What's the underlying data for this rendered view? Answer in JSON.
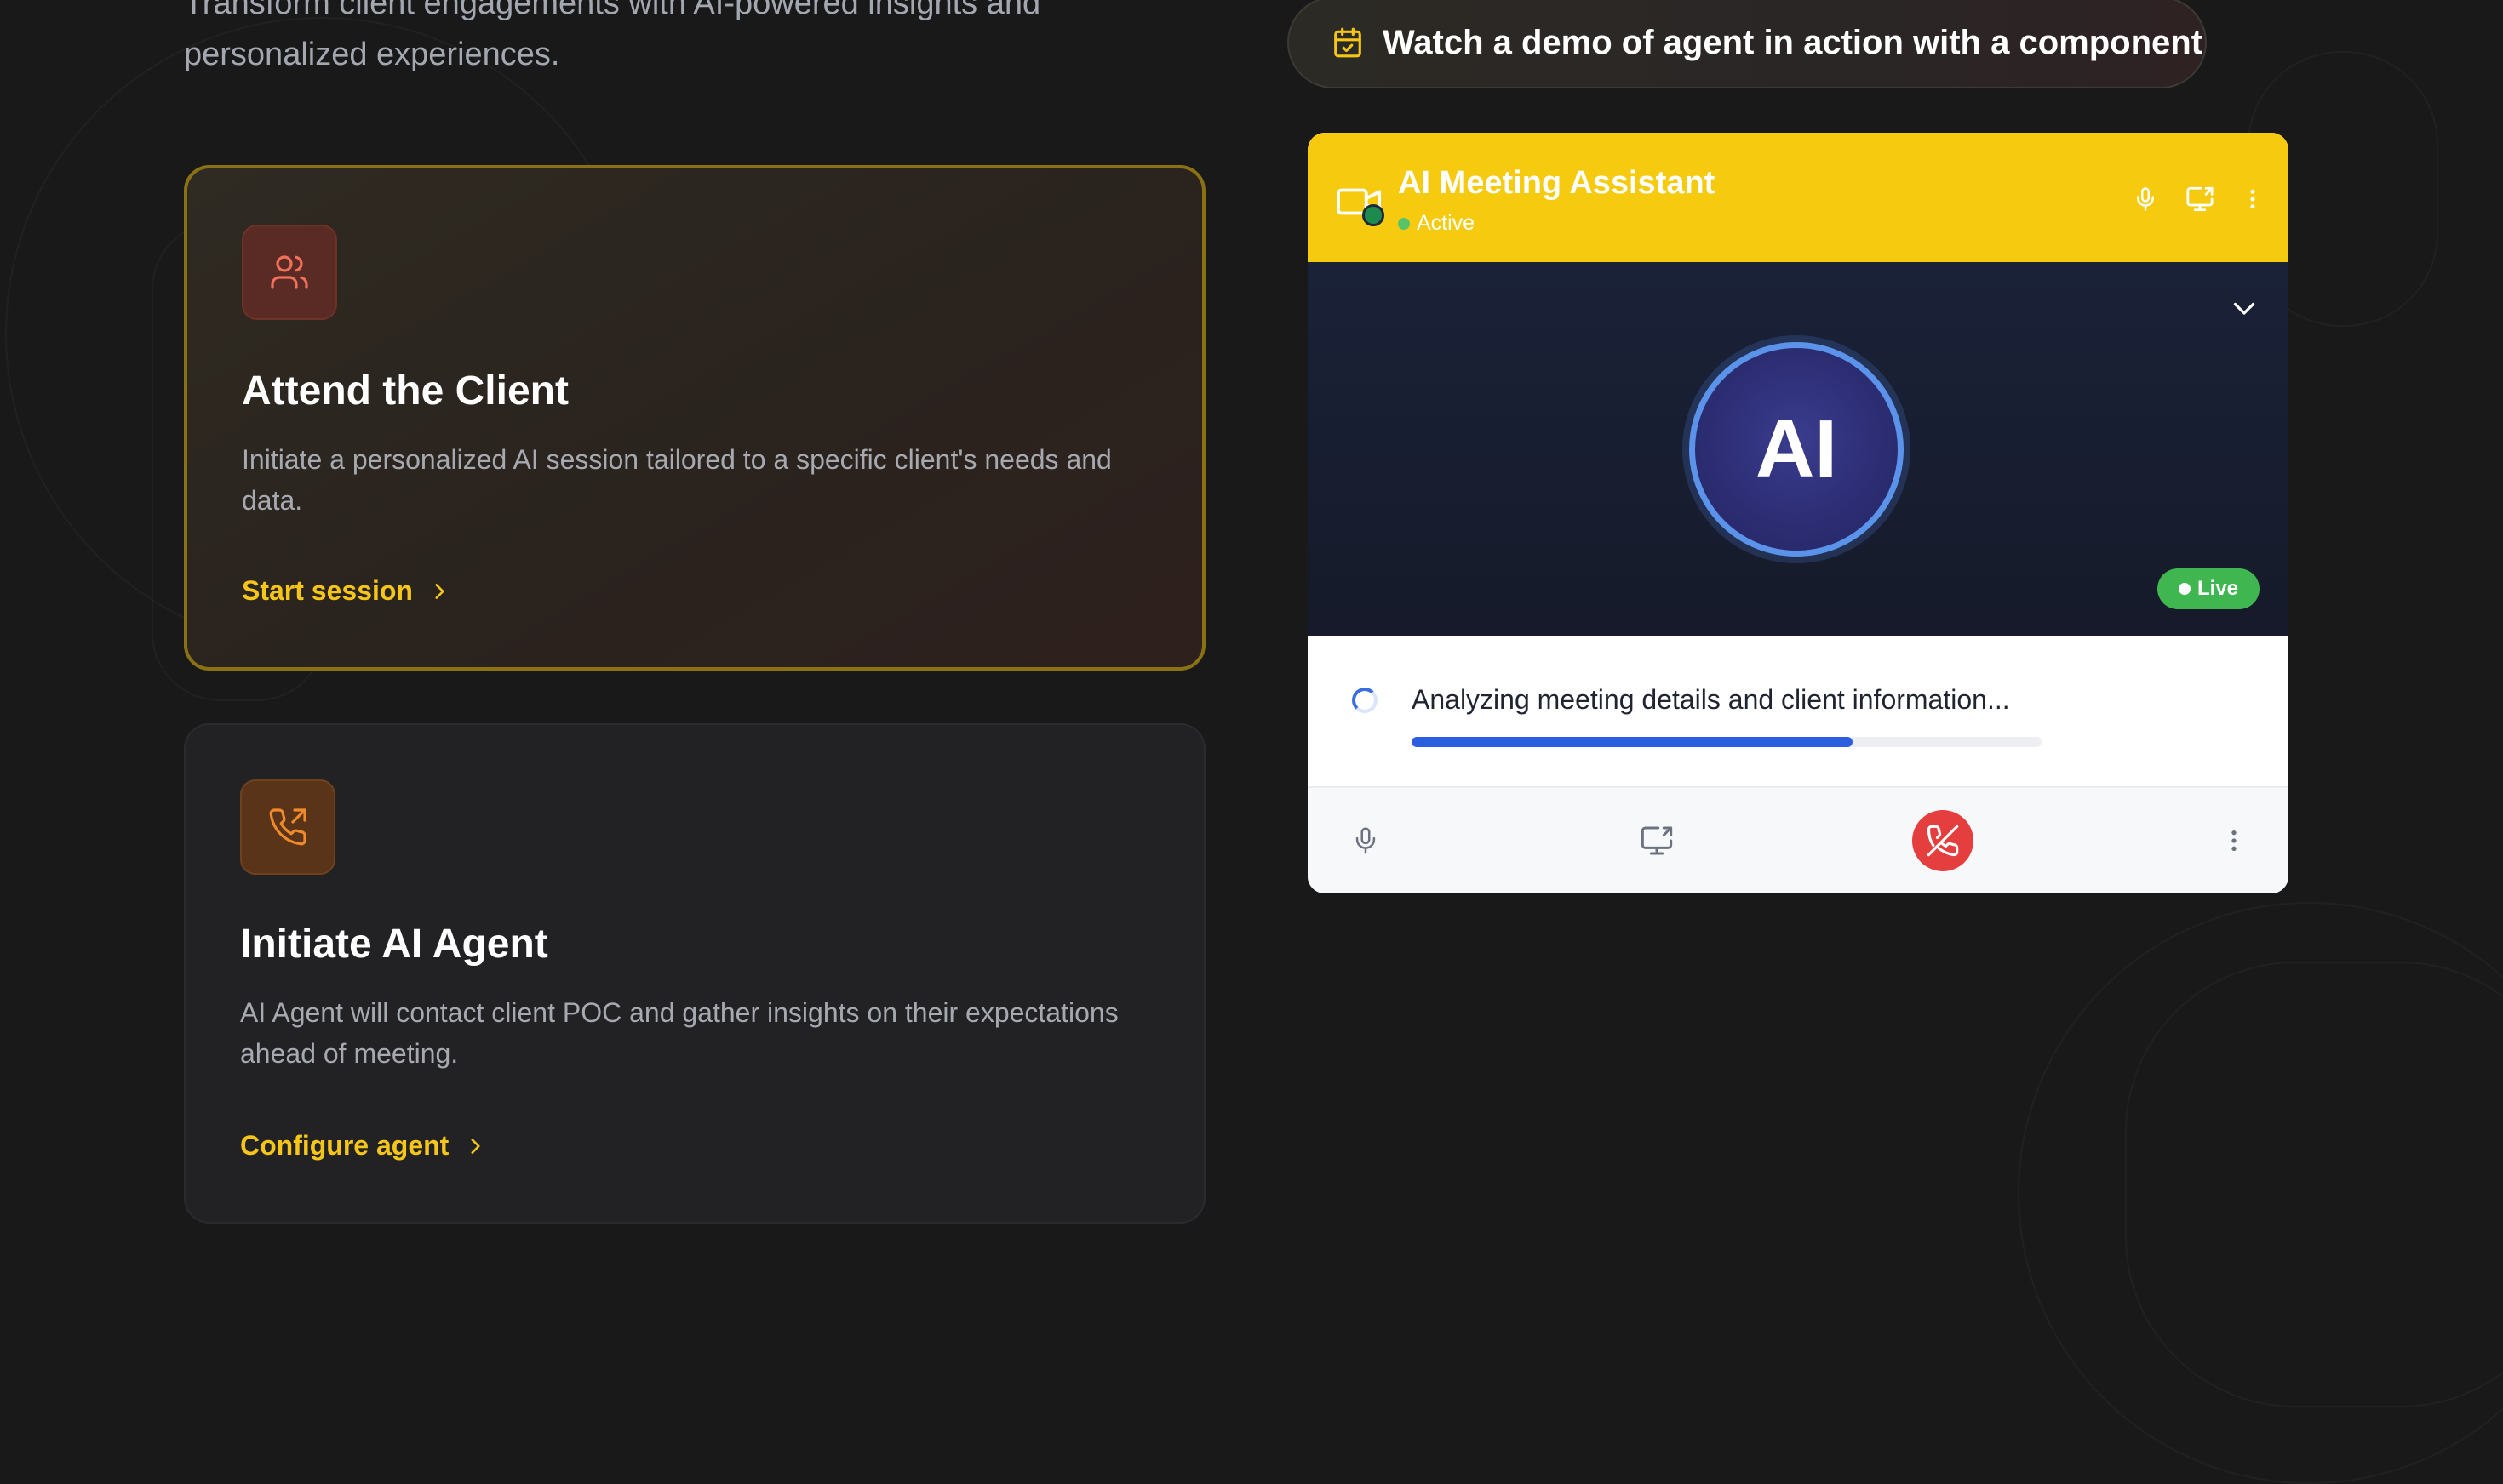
{
  "hero": {
    "subtitle": "Transform client engagements with AI-powered insights and personalized experiences."
  },
  "cards": [
    {
      "title": "Attend the Client",
      "description": "Initiate a personalized AI session tailored to a specific client's needs and data.",
      "link_label": "Start session",
      "icon": "users-icon"
    },
    {
      "title": "Initiate AI Agent",
      "description": "AI Agent will contact client POC and gather insights on their expectations ahead of meeting.",
      "link_label": "Configure agent",
      "icon": "phone-outgoing-icon"
    }
  ],
  "demo": {
    "label": "Watch a demo of agent in action with a component",
    "icon": "calendar-check-icon"
  },
  "widget": {
    "title": "AI Meeting Assistant",
    "status": "Active",
    "avatar_text": "AI",
    "live_label": "Live",
    "progress_text": "Analyzing meeting details and client information...",
    "progress_fraction": 0.7,
    "header_icons": [
      "mic-icon",
      "screen-share-icon",
      "more-vertical-icon"
    ],
    "control_icons": [
      "mic-icon",
      "screen-share-icon",
      "phone-off-icon",
      "more-vertical-icon"
    ]
  },
  "colors": {
    "accent": "#f5c518",
    "header_yellow": "#f5ca0f",
    "live_green": "#3fb650",
    "progress_blue": "#2c5fe0",
    "hangup_red": "#e53e3e",
    "page_bg": "#19191a"
  }
}
